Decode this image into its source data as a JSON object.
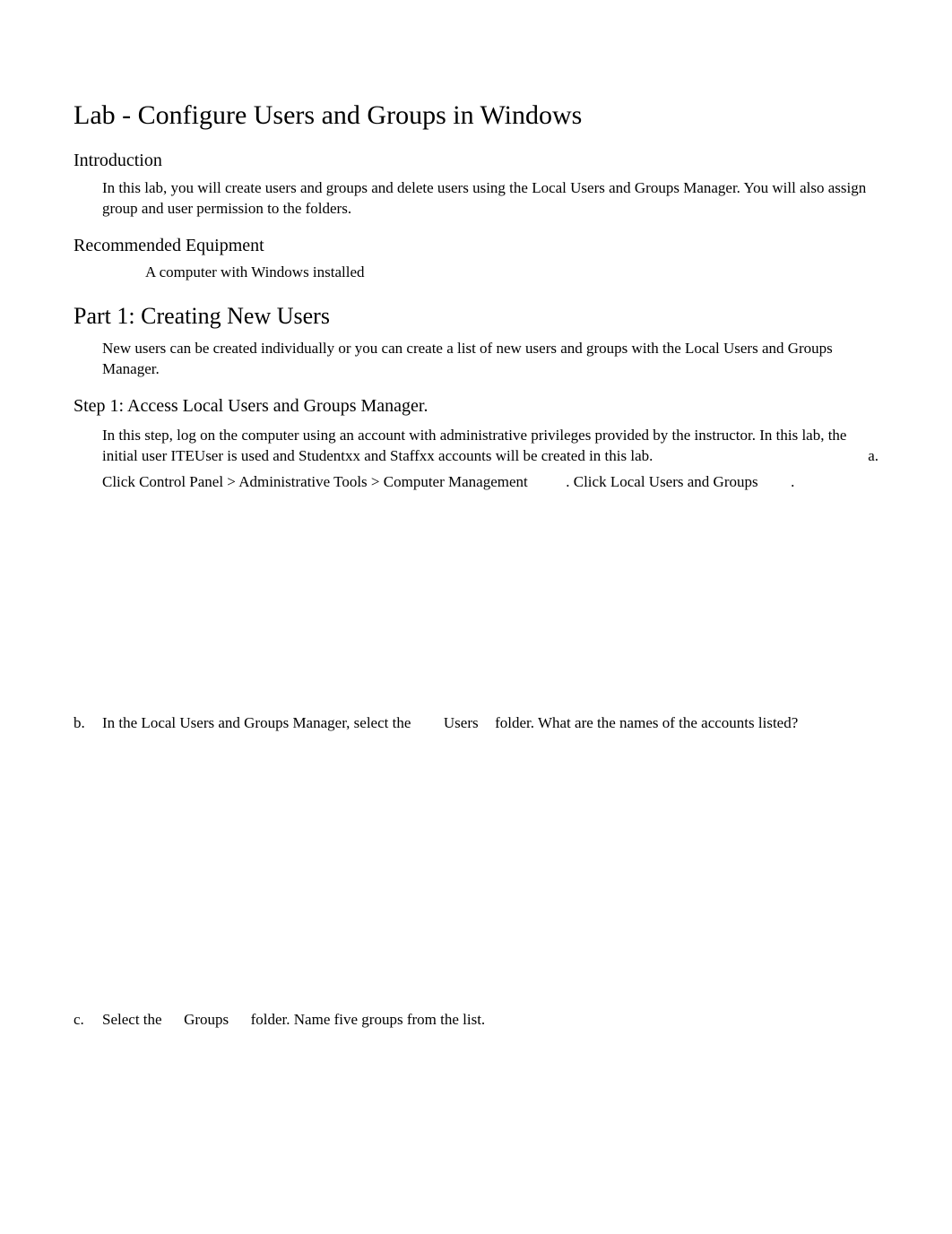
{
  "title": "Lab - Configure Users and Groups in Windows",
  "intro": {
    "heading": "Introduction",
    "text": "In this lab, you will create users and groups and delete users using the Local Users and Groups Manager. You will also assign group and user permission to the folders."
  },
  "equipment": {
    "heading": "Recommended Equipment",
    "bullet_glyph": "",
    "item": "A computer with Windows installed"
  },
  "part1": {
    "heading": "Part 1: Creating New Users",
    "intro": "New users can be created individually or you can create a list of new users and groups with the Local Users and Groups Manager."
  },
  "step1": {
    "heading": "Step 1: Access Local Users and Groups Manager.",
    "paragraph_prefix": "In this step, log on the computer using an account with administrative privileges provided by the instructor. In this lab, the initial user ITEUser is used and Studentxx and Staffxx accounts will be created in this lab.",
    "a_marker": "a.",
    "a_click": "Click",
    "a_path": "Control Panel > Administrative Tools > Computer Management",
    "a_mid": ". Click",
    "a_target": "Local Users and Groups",
    "a_end": ".",
    "b_marker": "b.",
    "b_prefix": "In the Local Users and Groups Manager, select the",
    "b_folder": "Users",
    "b_suffix": "folder. What are the names of the accounts listed?",
    "c_marker": "c.",
    "c_prefix": "Select the",
    "c_folder": "Groups",
    "c_suffix": "folder. Name five groups from the list."
  }
}
